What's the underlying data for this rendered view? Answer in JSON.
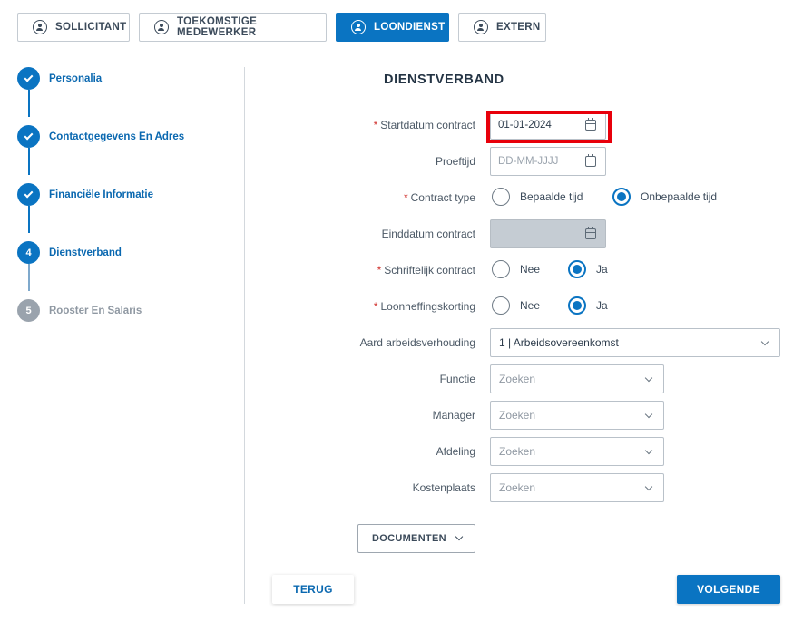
{
  "role_tabs": [
    {
      "label": "SOLLICITANT",
      "active": false
    },
    {
      "label": "TOEKOMSTIGE MEDEWERKER",
      "active": false
    },
    {
      "label": "LOONDIENST",
      "active": true
    },
    {
      "label": "EXTERN",
      "active": false
    }
  ],
  "steps": [
    {
      "marker": "",
      "label": "Personalia",
      "state": "done"
    },
    {
      "marker": "",
      "label": "Contactgegevens En Adres",
      "state": "done"
    },
    {
      "marker": "",
      "label": "Financiële Informatie",
      "state": "done"
    },
    {
      "marker": "4",
      "label": "Dienstverband",
      "state": "current"
    },
    {
      "marker": "5",
      "label": "Rooster En Salaris",
      "state": "todo"
    }
  ],
  "section_title": "DIENSTVERBAND",
  "required_mark": "*",
  "form": {
    "startdatum": {
      "label": "Startdatum contract",
      "value": "01-01-2024"
    },
    "proeftijd": {
      "label": "Proeftijd",
      "placeholder": "DD-MM-JJJJ"
    },
    "contract_type": {
      "label": "Contract type",
      "options": [
        "Bepaalde tijd",
        "Onbepaalde tijd"
      ],
      "selected": "Onbepaalde tijd"
    },
    "einddatum": {
      "label": "Einddatum contract",
      "value": ""
    },
    "schriftelijk": {
      "label": "Schriftelijk contract",
      "options": [
        "Nee",
        "Ja"
      ],
      "selected": "Ja"
    },
    "loonheffing": {
      "label": "Loonheffingskorting",
      "options": [
        "Nee",
        "Ja"
      ],
      "selected": "Ja"
    },
    "aard": {
      "label": "Aard arbeidsverhouding",
      "value": "1 | Arbeidsovereenkomst"
    },
    "functie": {
      "label": "Functie",
      "placeholder": "Zoeken"
    },
    "manager": {
      "label": "Manager",
      "placeholder": "Zoeken"
    },
    "afdeling": {
      "label": "Afdeling",
      "placeholder": "Zoeken"
    },
    "kostenplaats": {
      "label": "Kostenplaats",
      "placeholder": "Zoeken"
    }
  },
  "buttons": {
    "documenten": "DOCUMENTEN",
    "terug": "TERUG",
    "volgende": "VOLGENDE"
  },
  "colors": {
    "primary": "#0a74c2",
    "required": "#d0312d",
    "highlight": "#e8000b"
  }
}
